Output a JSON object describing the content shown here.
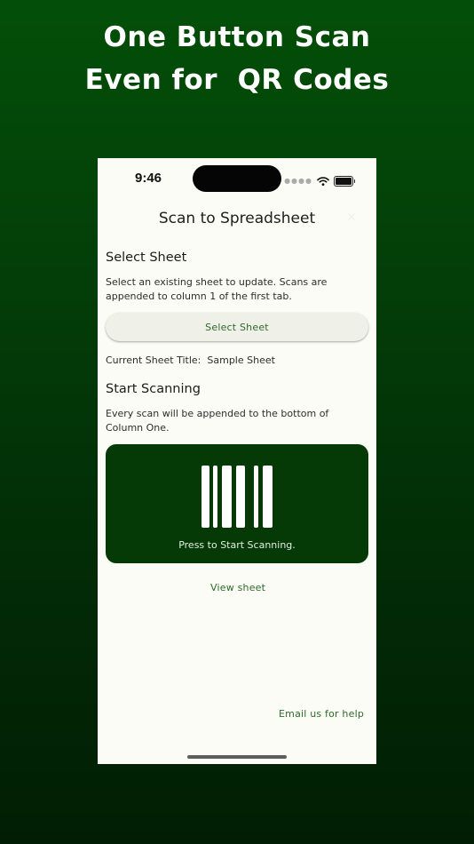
{
  "promo": {
    "line1": "One Button Scan",
    "line2": "Even for  QR Codes"
  },
  "status_bar": {
    "time": "9:46",
    "icons": [
      "signal-dots-icon",
      "wifi-icon",
      "battery-icon"
    ]
  },
  "header": {
    "title": "Scan to Spreadsheet",
    "close_icon": "close-icon"
  },
  "select_section": {
    "heading": "Select Sheet",
    "description": "Select an existing sheet to update. Scans are appended to column 1 of the first tab.",
    "button_label": "Select Sheet",
    "current_label": "Current Sheet Title:",
    "current_value": "Sample Sheet"
  },
  "scan_section": {
    "heading": "Start Scanning",
    "description": "Every scan will be appended to the bottom of Column One.",
    "button_label": "Press to Start Scanning.",
    "button_icon": "barcode-icon"
  },
  "links": {
    "view_sheet": "View sheet",
    "email_help": "Email us for help"
  },
  "colors": {
    "accent_green": "#2e6a28",
    "scan_button_bg": "#053a07",
    "page_bg": "#fbfcf6",
    "promo_bg": "#034f08"
  }
}
